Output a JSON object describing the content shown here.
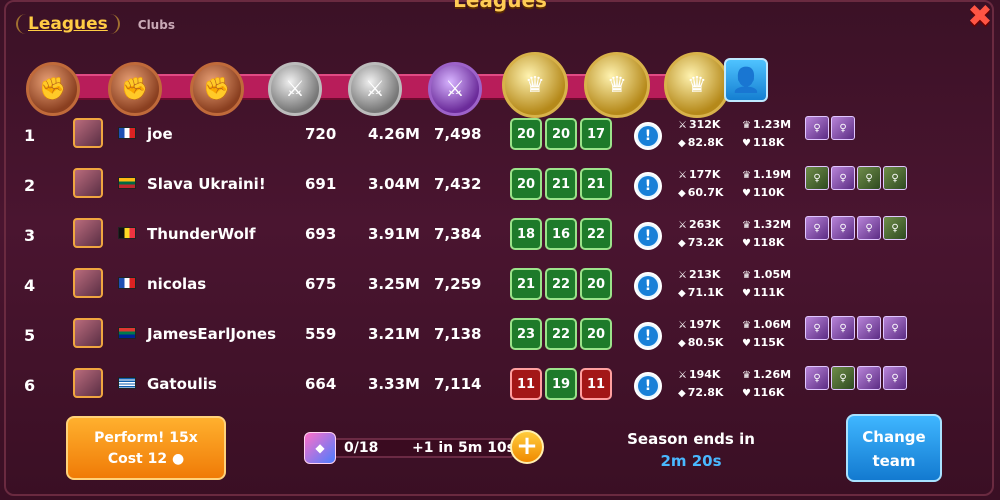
{
  "window": {
    "title": "Leagues"
  },
  "tabs": [
    {
      "label": "Leagues"
    },
    {
      "label": "Clubs"
    }
  ],
  "leaderboard": [
    {
      "rank": "1",
      "name": "joe",
      "flag": "fr",
      "level": "720",
      "power": "4.26M",
      "points": "7,498",
      "boxes": [
        {
          "v": "20",
          "c": "green"
        },
        {
          "v": "20",
          "c": "green"
        },
        {
          "v": "17",
          "c": "green"
        }
      ],
      "stats": [
        "312K",
        "1.23M",
        "82.8K",
        "118K"
      ],
      "team_colors": [
        "purple",
        "purple"
      ]
    },
    {
      "rank": "2",
      "name": "Slava Ukraini!",
      "flag": "lt",
      "level": "691",
      "power": "3.04M",
      "points": "7,432",
      "boxes": [
        {
          "v": "20",
          "c": "green"
        },
        {
          "v": "21",
          "c": "green"
        },
        {
          "v": "21",
          "c": "green"
        }
      ],
      "stats": [
        "177K",
        "1.19M",
        "60.7K",
        "110K"
      ],
      "team_colors": [
        "green",
        "purple",
        "green",
        "green"
      ]
    },
    {
      "rank": "3",
      "name": "ThunderWolf",
      "flag": "be",
      "level": "693",
      "power": "3.91M",
      "points": "7,384",
      "boxes": [
        {
          "v": "18",
          "c": "green"
        },
        {
          "v": "16",
          "c": "green"
        },
        {
          "v": "22",
          "c": "green"
        }
      ],
      "stats": [
        "263K",
        "1.32M",
        "73.2K",
        "118K"
      ],
      "team_colors": [
        "purple",
        "purple",
        "purple",
        "green"
      ]
    },
    {
      "rank": "4",
      "name": "nicolas",
      "flag": "fr",
      "level": "675",
      "power": "3.25M",
      "points": "7,259",
      "boxes": [
        {
          "v": "21",
          "c": "green"
        },
        {
          "v": "22",
          "c": "green"
        },
        {
          "v": "20",
          "c": "green"
        }
      ],
      "stats": [
        "213K",
        "1.05M",
        "71.1K",
        "111K"
      ],
      "team_colors": []
    },
    {
      "rank": "5",
      "name": "JamesEarlJones",
      "flag": "za",
      "level": "559",
      "power": "3.21M",
      "points": "7,138",
      "boxes": [
        {
          "v": "23",
          "c": "green"
        },
        {
          "v": "22",
          "c": "green"
        },
        {
          "v": "20",
          "c": "green"
        }
      ],
      "stats": [
        "197K",
        "1.06M",
        "80.5K",
        "115K"
      ],
      "team_colors": [
        "purple",
        "purple",
        "purple",
        "purple"
      ]
    },
    {
      "rank": "6",
      "name": "Gatoulis",
      "flag": "gr",
      "level": "664",
      "power": "3.33M",
      "points": "7,114",
      "boxes": [
        {
          "v": "11",
          "c": "red"
        },
        {
          "v": "19",
          "c": "green"
        },
        {
          "v": "11",
          "c": "red"
        }
      ],
      "stats": [
        "194K",
        "1.26M",
        "72.8K",
        "116K"
      ],
      "team_colors": [
        "purple",
        "green",
        "purple",
        "purple"
      ]
    }
  ],
  "footer": {
    "perform_line1": "Perform! 15x",
    "perform_line2": "Cost 12",
    "energy_count": "0/18",
    "energy_next": "+1 in 5m 10s",
    "plus_label": "+",
    "season_label": "Season ends in",
    "season_time": "2m 20s",
    "change_line1": "Change",
    "change_line2": "team"
  },
  "icons": {
    "close": "close-icon",
    "info": "info-icon",
    "team": "team-icon"
  },
  "colors": {
    "accent": "#ffcc44",
    "track": "#b81d5a",
    "green_box": "#1e7a2a",
    "red_box": "#a31717",
    "blue": "#49b8ff"
  }
}
